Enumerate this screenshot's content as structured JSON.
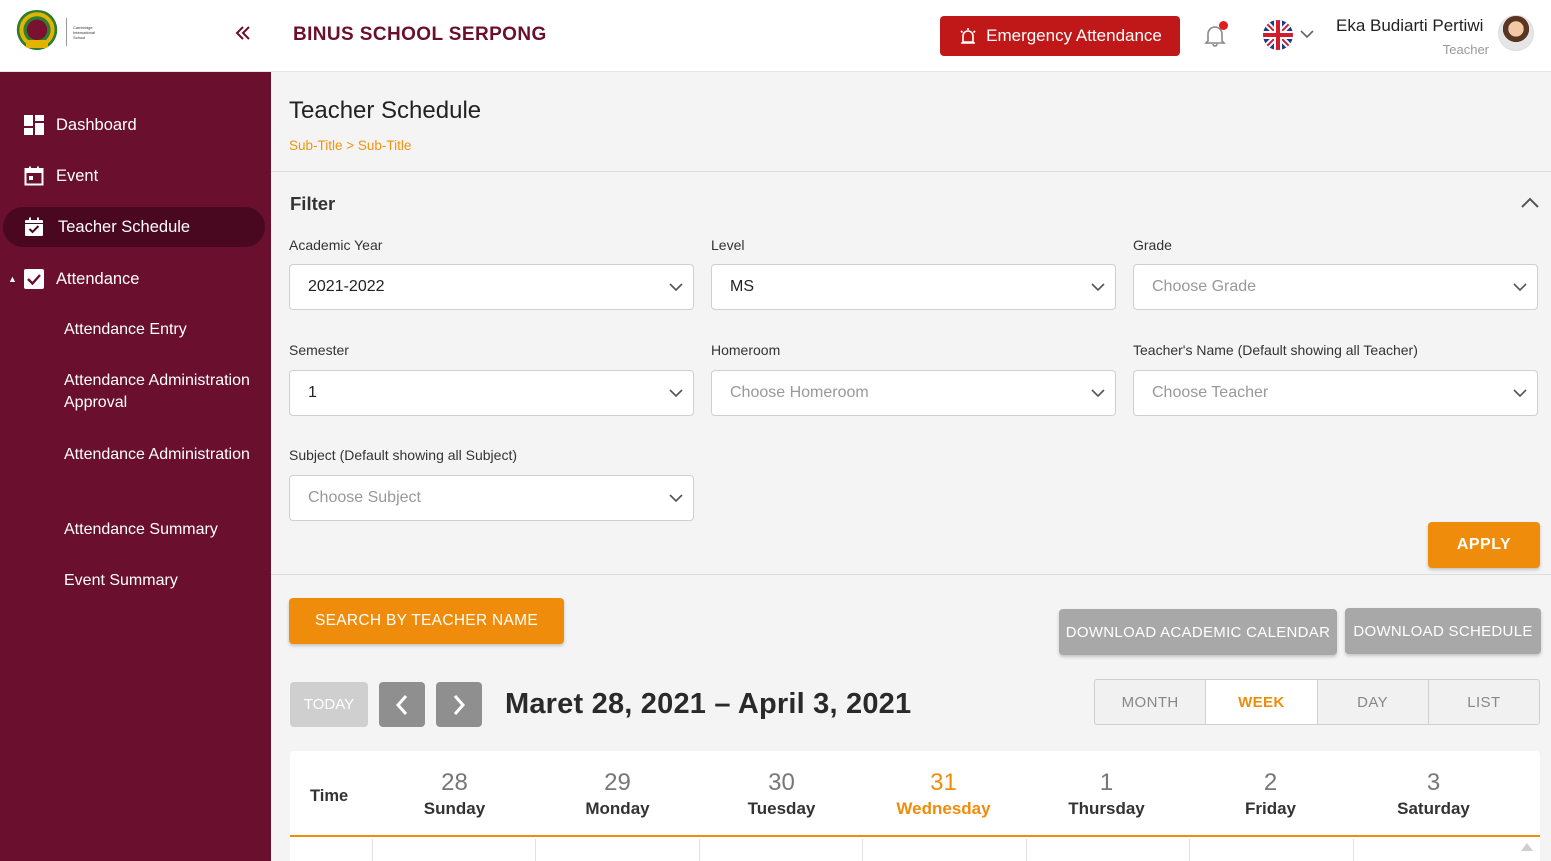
{
  "header": {
    "logo_alt": "BINUS SCHOOL Cambridge International School",
    "collapse_icon": "double-chevron-left-icon",
    "school_name": "BINUS SCHOOL SERPONG",
    "emergency_label": "Emergency Attendance",
    "user_name": "Eka Budiarti Pertiwi",
    "user_role": "Teacher"
  },
  "sidebar": {
    "items": [
      {
        "label": "Dashboard",
        "icon": "dashboard-icon"
      },
      {
        "label": "Event",
        "icon": "calendar-icon"
      },
      {
        "label": "Teacher Schedule",
        "icon": "calendar-check-icon"
      },
      {
        "label": "Attendance",
        "icon": "checkbox-icon"
      }
    ],
    "sub_items": [
      "Attendance Entry",
      "Attendance Administration Approval",
      "Attendance Administration",
      "Attendance Summary",
      "Event Summary"
    ]
  },
  "page": {
    "title": "Teacher Schedule",
    "breadcrumb": "Sub-Title > Sub-Title"
  },
  "filter": {
    "title": "Filter",
    "fields": [
      {
        "label": "Academic Year",
        "value": "2021-2022"
      },
      {
        "label": "Level",
        "value": "MS"
      },
      {
        "label": "Grade",
        "value": "Choose Grade"
      },
      {
        "label": "Semester",
        "value": "1"
      },
      {
        "label": "Homeroom",
        "value": "Choose Homeroom"
      },
      {
        "label": "Teacher's Name (Default showing all Teacher)",
        "value": "Choose Teacher"
      },
      {
        "label": "Subject (Default showing all Subject)",
        "value": "Choose Subject"
      }
    ],
    "apply_label": "APPLY"
  },
  "actions": {
    "search_teacher": "SEARCH BY TEACHER NAME",
    "download_calendar": "DOWNLOAD ACADEMIC CALENDAR",
    "download_schedule": "DOWNLOAD SCHEDULE"
  },
  "calendar": {
    "today_label": "TODAY",
    "range": "Maret 28, 2021 – April 3, 2021",
    "views": [
      "MONTH",
      "WEEK",
      "DAY",
      "LIST"
    ],
    "active_view": "WEEK",
    "time_label": "Time",
    "days": [
      {
        "num": "28",
        "name": "Sunday"
      },
      {
        "num": "29",
        "name": "Monday"
      },
      {
        "num": "30",
        "name": "Tuesday"
      },
      {
        "num": "31",
        "name": "Wednesday"
      },
      {
        "num": "1",
        "name": "Thursday"
      },
      {
        "num": "2",
        "name": "Friday"
      },
      {
        "num": "3",
        "name": "Saturday"
      }
    ],
    "today_index": 3
  },
  "colors": {
    "brand": "#6b0f2e",
    "accent": "#f08c0c",
    "emergency": "#c01818"
  }
}
